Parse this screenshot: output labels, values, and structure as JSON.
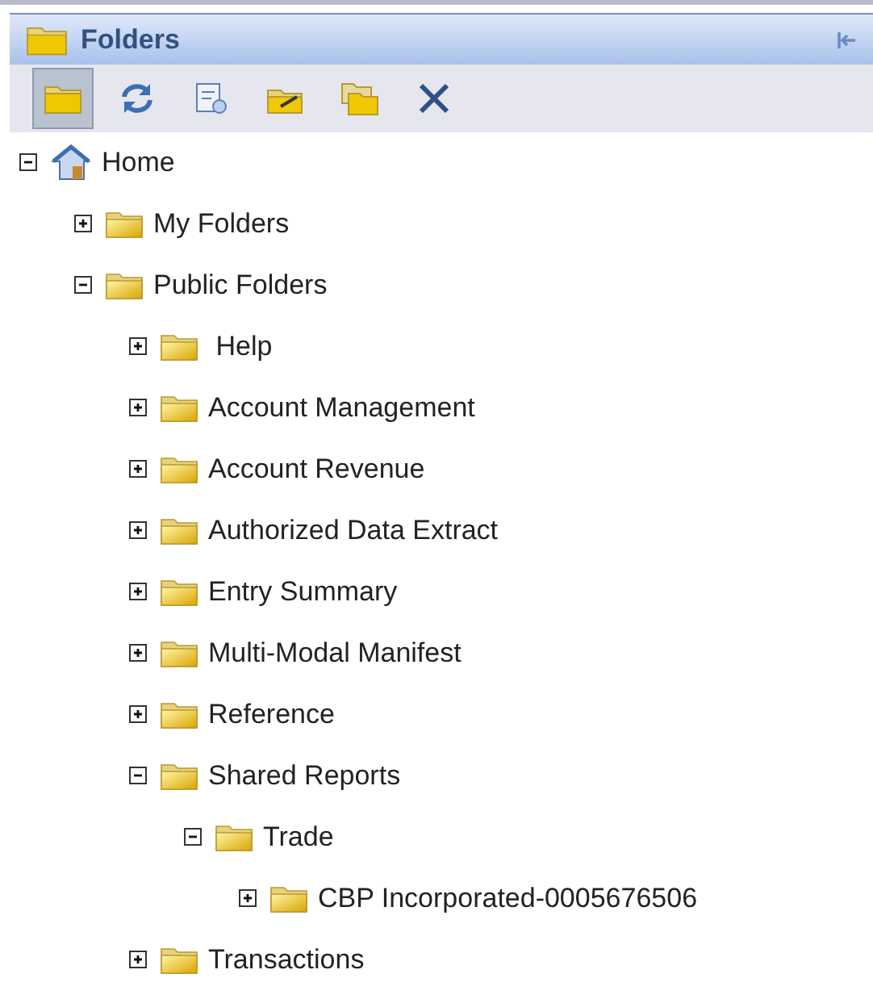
{
  "panel": {
    "title": "Folders"
  },
  "toolbar": [
    {
      "kind": "folder",
      "selected": true
    },
    {
      "kind": "refresh",
      "selected": false
    },
    {
      "kind": "properties",
      "selected": false
    },
    {
      "kind": "edit",
      "selected": false
    },
    {
      "kind": "copy",
      "selected": false
    },
    {
      "kind": "delete",
      "selected": false
    }
  ],
  "tree": [
    {
      "label": "Home",
      "kind": "home",
      "expanded": true,
      "children": [
        {
          "label": "My Folders",
          "kind": "folder",
          "expanded": false
        },
        {
          "label": "Public Folders",
          "kind": "folder",
          "expanded": true,
          "children": [
            {
              "label": " Help",
              "kind": "folder",
              "expanded": false
            },
            {
              "label": "Account Management",
              "kind": "folder",
              "expanded": false
            },
            {
              "label": "Account Revenue",
              "kind": "folder",
              "expanded": false
            },
            {
              "label": "Authorized Data Extract",
              "kind": "folder",
              "expanded": false
            },
            {
              "label": "Entry Summary",
              "kind": "folder",
              "expanded": false
            },
            {
              "label": "Multi-Modal Manifest",
              "kind": "folder",
              "expanded": false
            },
            {
              "label": "Reference",
              "kind": "folder",
              "expanded": false
            },
            {
              "label": "Shared Reports",
              "kind": "folder",
              "expanded": true,
              "children": [
                {
                  "label": "Trade",
                  "kind": "folder",
                  "expanded": true,
                  "children": [
                    {
                      "label": "CBP Incorporated-0005676506",
                      "kind": "folder",
                      "expanded": false
                    }
                  ]
                }
              ]
            },
            {
              "label": "Transactions",
              "kind": "folder",
              "expanded": false
            }
          ]
        }
      ]
    }
  ]
}
